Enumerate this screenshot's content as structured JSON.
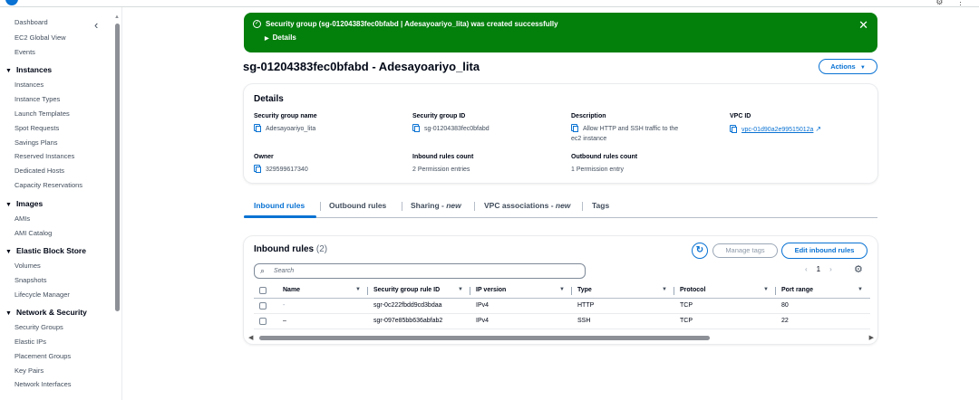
{
  "sidebar": {
    "items": [
      {
        "label": "Dashboard"
      },
      {
        "label": "EC2 Global View"
      },
      {
        "label": "Events"
      }
    ],
    "groups": [
      {
        "label": "Instances",
        "items": [
          "Instances",
          "Instance Types",
          "Launch Templates",
          "Spot Requests",
          "Savings Plans",
          "Reserved Instances",
          "Dedicated Hosts",
          "Capacity Reservations"
        ]
      },
      {
        "label": "Images",
        "items": [
          "AMIs",
          "AMI Catalog"
        ]
      },
      {
        "label": "Elastic Block Store",
        "items": [
          "Volumes",
          "Snapshots",
          "Lifecycle Manager"
        ]
      },
      {
        "label": "Network & Security",
        "items": [
          "Security Groups",
          "Elastic IPs",
          "Placement Groups",
          "Key Pairs",
          "Network Interfaces"
        ]
      }
    ]
  },
  "flash": {
    "message": "Security group (sg-01204383fec0bfabd | Adesayoariyo_lita) was created successfully",
    "details": "Details",
    "status_color": "#037f0c"
  },
  "page": {
    "title": "sg-01204383fec0bfabd - Adesayoariyo_lita",
    "actions_label": "Actions"
  },
  "details": {
    "heading": "Details",
    "sg_name_label": "Security group name",
    "sg_name": "Adesayoariyo_lita",
    "sg_id_label": "Security group ID",
    "sg_id": "sg-01204383fec0bfabd",
    "description_label": "Description",
    "description_line1": "Allow HTTP and SSH traffic to the",
    "description_line2": "ec2 instance",
    "vpc_label": "VPC ID",
    "vpc_id": "vpc-01d90a2e99515012a",
    "owner_label": "Owner",
    "owner": "329599617340",
    "inbound_count_label": "Inbound rules count",
    "inbound_count": "2 Permission entries",
    "outbound_count_label": "Outbound rules count",
    "outbound_count": "1 Permission entry"
  },
  "tabs": [
    {
      "label": "Inbound rules"
    },
    {
      "label": "Outbound rules"
    },
    {
      "label": "Sharing - ",
      "badge": "new"
    },
    {
      "label": "VPC associations - ",
      "badge": "new"
    },
    {
      "label": "Tags"
    }
  ],
  "inbound": {
    "heading": "Inbound rules",
    "count": "(2)",
    "manage_tags": "Manage tags",
    "edit_rules": "Edit inbound rules",
    "search_placeholder": "Search",
    "page": "1",
    "columns": [
      "Name",
      "Security group rule ID",
      "IP version",
      "Type",
      "Protocol",
      "Port range"
    ],
    "rows": [
      {
        "name": "-",
        "rule_id": "sgr-0c222fbdd9cd3bdaa",
        "ip": "IPv4",
        "type": "HTTP",
        "protocol": "TCP",
        "port": "80"
      },
      {
        "name": "–",
        "rule_id": "sgr-097e85bb636abfab2",
        "ip": "IPv4",
        "type": "SSH",
        "protocol": "TCP",
        "port": "22"
      }
    ],
    "accent_color": "#0972d3"
  }
}
